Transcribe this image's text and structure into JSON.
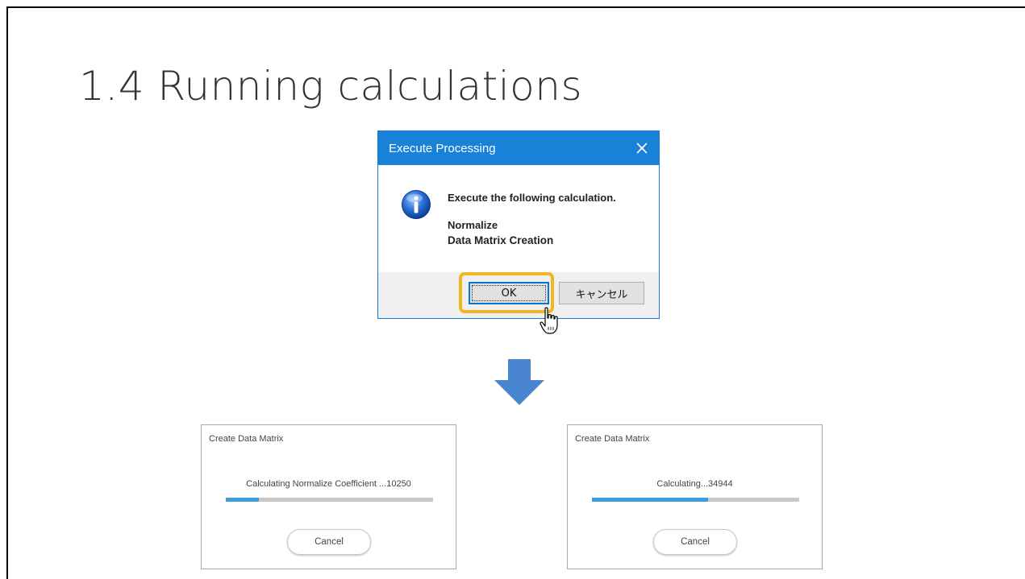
{
  "slide": {
    "title": "1.4 Running calculations"
  },
  "execute_dialog": {
    "title": "Execute Processing",
    "message": "Execute the following calculation.",
    "items": [
      "Normalize",
      "Data Matrix Creation"
    ],
    "ok_label": "OK",
    "cancel_label": "キャンセル",
    "icons": {
      "info": "info-icon",
      "close": "close-icon",
      "cursor": "hand-pointer-icon"
    },
    "colors": {
      "titlebar": "#1982d8",
      "highlight": "#f2b720"
    }
  },
  "arrow": {
    "icon": "down-arrow-icon",
    "color": "#4a86cf"
  },
  "progress_dialogs": [
    {
      "title": "Create Data Matrix",
      "status": "Calculating Normalize Coefficient ...10250",
      "progress": 0.16,
      "cancel_label": "Cancel"
    },
    {
      "title": "Create Data Matrix",
      "status": "Calculating...34944",
      "progress": 0.56,
      "cancel_label": "Cancel"
    }
  ]
}
